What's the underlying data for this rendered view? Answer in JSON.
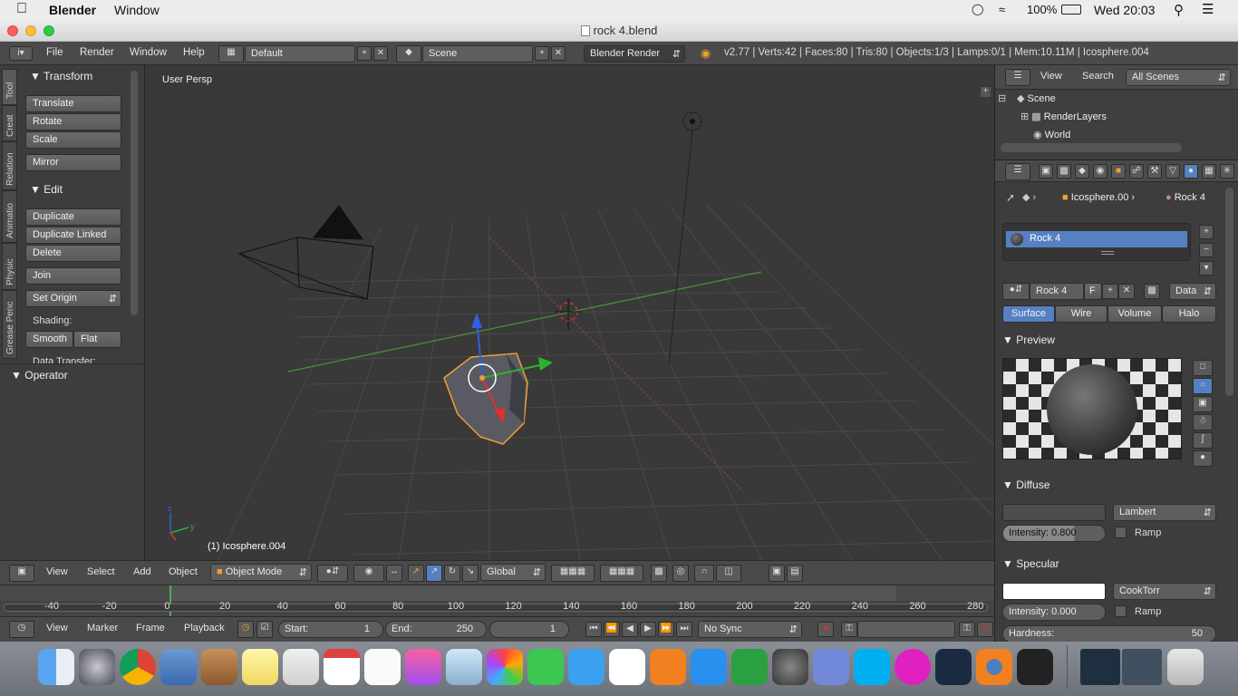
{
  "mac_menubar": {
    "app_name": "Blender",
    "window_menu": "Window",
    "battery": "100%",
    "clock": "Wed 20:03"
  },
  "window": {
    "title": "rock 4.blend"
  },
  "info_header": {
    "menus": [
      "File",
      "Render",
      "Window",
      "Help"
    ],
    "screen_layout": "Default",
    "scene": "Scene",
    "engine": "Blender Render",
    "stats": "v2.77 | Verts:42 | Faces:80 | Tris:80 | Objects:1/3 | Lamps:0/1 | Mem:10.11M | Icosphere.004"
  },
  "tool_shelf": {
    "tabs": [
      "Tool",
      "Creat",
      "Relation",
      "Animatio",
      "Physic",
      "Grease Penc"
    ],
    "transform_title": "Transform",
    "translate": "Translate",
    "rotate": "Rotate",
    "scale": "Scale",
    "mirror": "Mirror",
    "edit_title": "Edit",
    "duplicate": "Duplicate",
    "duplicate_linked": "Duplicate Linked",
    "delete": "Delete",
    "join": "Join",
    "set_origin": "Set Origin",
    "shading_label": "Shading:",
    "smooth": "Smooth",
    "flat": "Flat",
    "data_transfer": "Data Transfer:",
    "operator_title": "Operator"
  },
  "viewport": {
    "view_label": "User Persp",
    "object_label": "(1) Icosphere.004"
  },
  "viewport_header": {
    "menus": [
      "View",
      "Select",
      "Add",
      "Object"
    ],
    "mode": "Object Mode",
    "orientation": "Global"
  },
  "timeline": {
    "ticks": [
      "-40",
      "-20",
      "0",
      "20",
      "40",
      "60",
      "80",
      "100",
      "120",
      "140",
      "160",
      "180",
      "200",
      "220",
      "240",
      "260",
      "280"
    ],
    "menus": [
      "View",
      "Marker",
      "Frame",
      "Playback"
    ],
    "start_label": "Start:",
    "start_value": "1",
    "end_label": "End:",
    "end_value": "250",
    "current_frame": "1",
    "sync": "No Sync"
  },
  "outliner": {
    "view": "View",
    "search": "Search",
    "filter": "All Scenes",
    "items": [
      "Scene",
      "RenderLayers",
      "World"
    ]
  },
  "properties": {
    "breadcrumb_object": "Icosphere.00",
    "breadcrumb_material": "Rock 4",
    "material_slot": "Rock 4",
    "material_name": "Rock 4",
    "fake_user": "F",
    "link": "Data",
    "tabs": [
      "Surface",
      "Wire",
      "Volume",
      "Halo"
    ],
    "preview_title": "Preview",
    "diffuse_title": "Diffuse",
    "diffuse_shader": "Lambert",
    "diffuse_intensity": "Intensity: 0.800",
    "ramp": "Ramp",
    "specular_title": "Specular",
    "specular_shader": "CookTorr",
    "specular_intensity": "Intensity: 0.000",
    "hardness_label": "Hardness:",
    "hardness_value": "50"
  },
  "colors": {
    "selection_orange": "#f0a030",
    "active_blue": "#5680c2",
    "x_axis": "#c03030",
    "y_axis": "#30a030",
    "z_axis": "#3060e0"
  }
}
